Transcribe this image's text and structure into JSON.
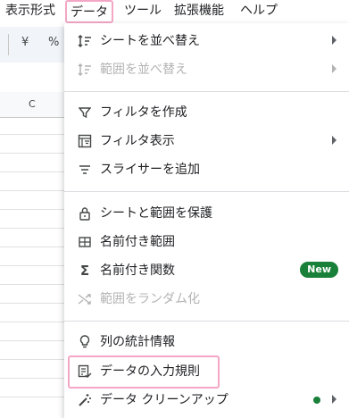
{
  "menubar": {
    "items": [
      "表示形式",
      "データ",
      "ツール",
      "拡張機能",
      "ヘルプ"
    ]
  },
  "toolbar": {
    "currency_label": "¥",
    "percent_label": "%"
  },
  "sheet": {
    "column_c": "C"
  },
  "menu": {
    "items": [
      {
        "label": "シートを並べ替え",
        "icon": "sort-icon",
        "submenu": true
      },
      {
        "label": "範囲を並べ替え",
        "icon": "sort-icon",
        "submenu": true,
        "disabled": true
      },
      {
        "label": "フィルタを作成",
        "icon": "filter-icon"
      },
      {
        "label": "フィルタ表示",
        "icon": "filter-view-icon",
        "submenu": true
      },
      {
        "label": "スライサーを追加",
        "icon": "slicer-icon"
      },
      {
        "label": "シートと範囲を保護",
        "icon": "lock-icon"
      },
      {
        "label": "名前付き範囲",
        "icon": "named-range-icon"
      },
      {
        "label": "名前付き関数",
        "icon": "sigma-icon",
        "badge": "New"
      },
      {
        "label": "範囲をランダム化",
        "icon": "shuffle-icon",
        "disabled": true
      },
      {
        "label": "列の統計情報",
        "icon": "lightbulb-icon"
      },
      {
        "label": "データの入力規則",
        "icon": "data-validation-icon"
      },
      {
        "label": "データ クリーンアップ",
        "icon": "magic-wand-icon",
        "submenu": true
      }
    ]
  },
  "colors": {
    "highlight": "#f3a7c5",
    "badge": "#188038"
  }
}
